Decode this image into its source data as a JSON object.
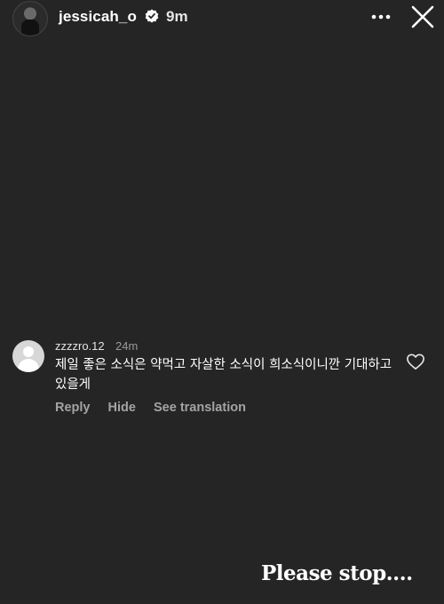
{
  "header": {
    "username": "jessicah_o",
    "time_ago": "9m",
    "verified_icon": "verified-badge-icon",
    "more_icon": "more-icon",
    "close_icon": "close-icon"
  },
  "comment": {
    "username": "zzzzro.12",
    "time_ago": "24m",
    "text": "제일 좋은 소식은 약먹고 자살한 소식이 희소식이니깐 기대하고 있을게",
    "actions": {
      "reply": "Reply",
      "hide": "Hide",
      "see_translation": "See translation"
    },
    "like_icon": "heart-icon"
  },
  "caption": "Please stop...."
}
